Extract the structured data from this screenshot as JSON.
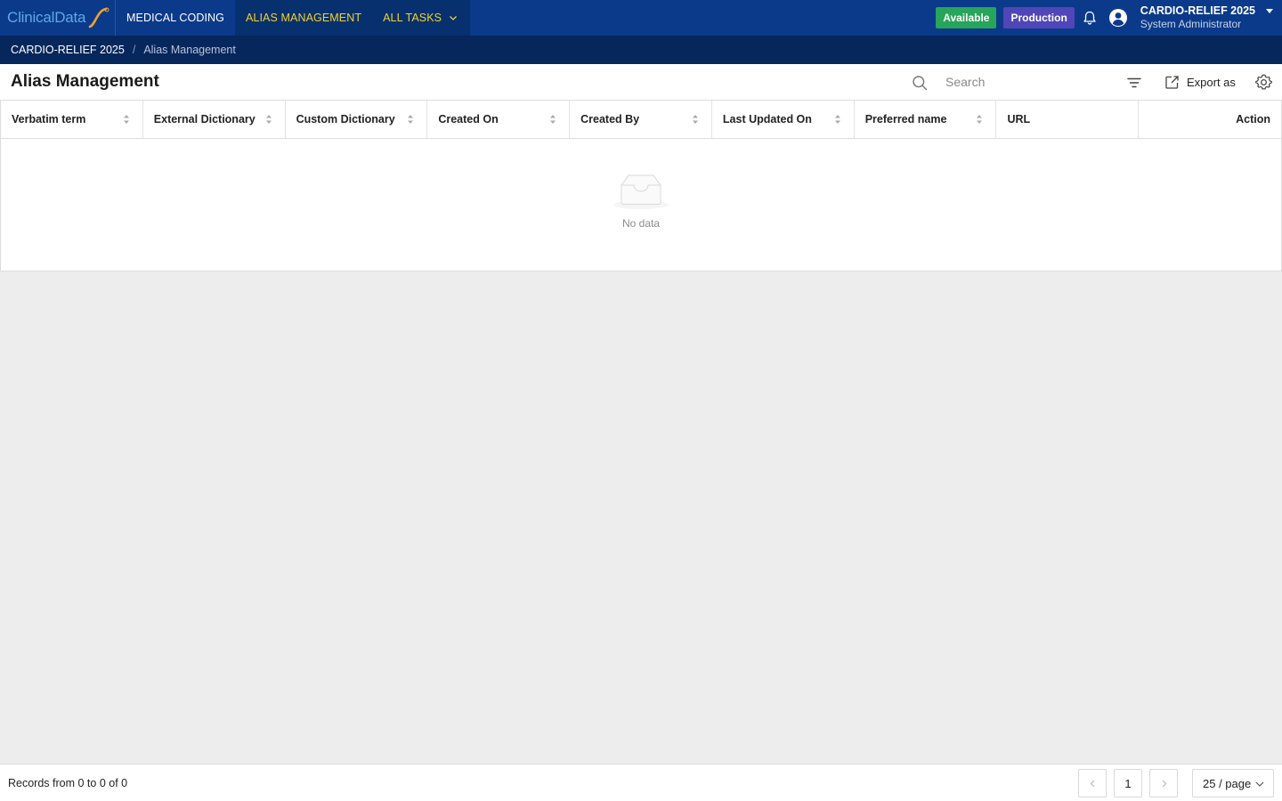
{
  "brand": {
    "logo_text": "ClinicalData"
  },
  "nav": {
    "items": [
      {
        "label": "MEDICAL CODING"
      },
      {
        "label": "ALIAS MANAGEMENT"
      },
      {
        "label": "ALL TASKS"
      }
    ]
  },
  "status": {
    "available": "Available",
    "environment": "Production"
  },
  "user": {
    "study": "CARDIO-RELIEF 2025",
    "role": "System Administrator"
  },
  "breadcrumb": {
    "root": "CARDIO-RELIEF 2025",
    "separator": "/",
    "current": "Alias Management"
  },
  "page": {
    "title": "Alias Management"
  },
  "toolbar": {
    "search_placeholder": "Search",
    "export_label": "Export as"
  },
  "table": {
    "columns": [
      "Verbatim term",
      "External Dictionary",
      "Custom Dictionary",
      "Created On",
      "Created By",
      "Last Updated On",
      "Preferred name",
      "URL",
      "Action"
    ],
    "rows": [],
    "empty_text": "No data"
  },
  "footer": {
    "records_text": "Records from 0 to 0 of 0",
    "current_page": "1",
    "page_size": "25 / page"
  },
  "colors": {
    "nav_bg": "#0b3a8a",
    "breadcrumb_bg": "#06275c",
    "active_nav_text": "#f1d42a",
    "available": "#27a55a",
    "production": "#5046b8"
  }
}
